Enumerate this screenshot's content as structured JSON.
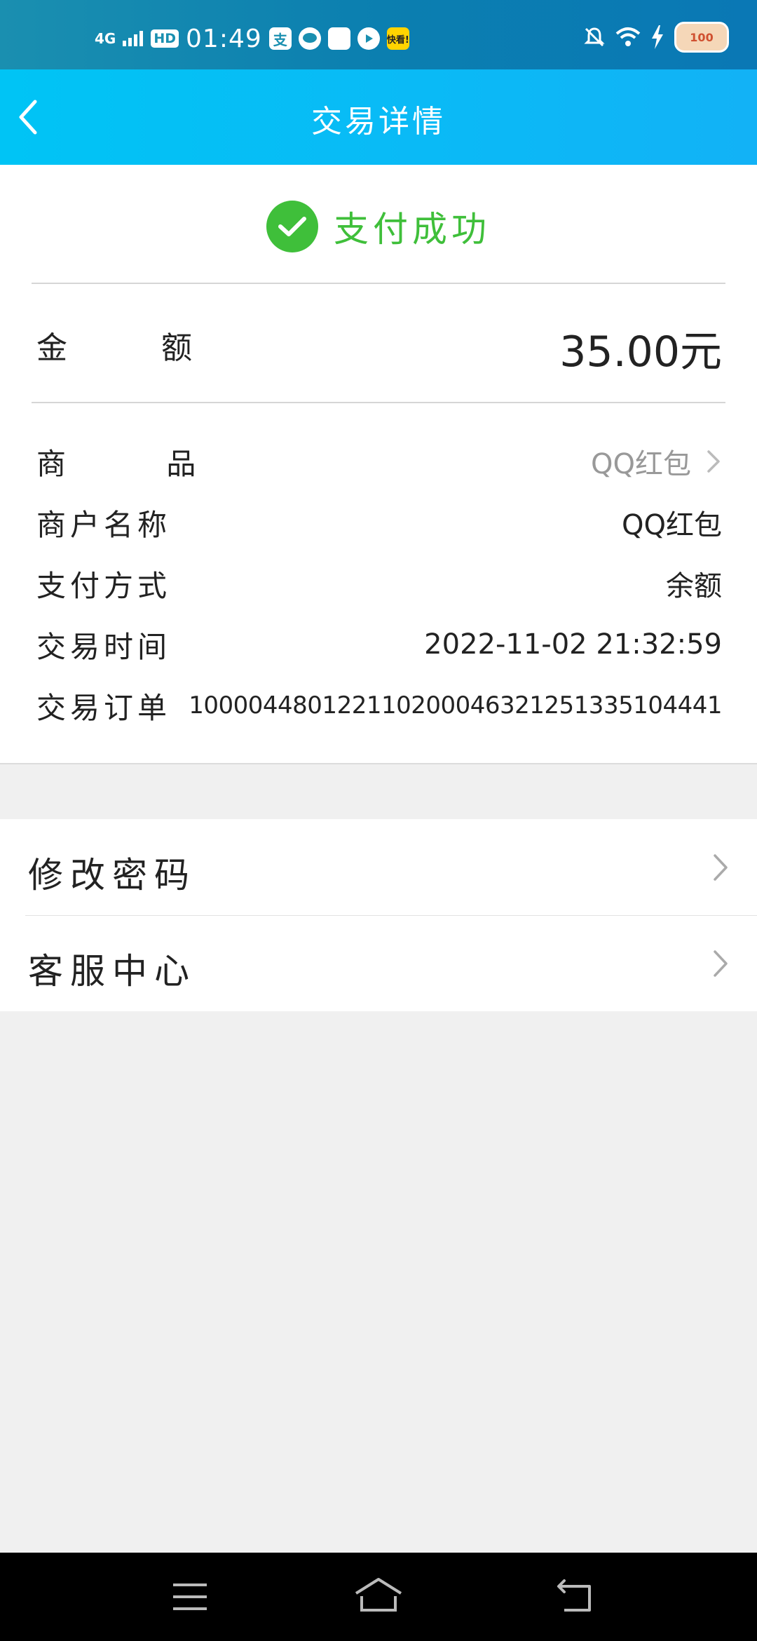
{
  "status_bar": {
    "signal": "4G",
    "hd": "HD",
    "time": "01:49",
    "app_icons": [
      "alipay-icon",
      "message-icon",
      "app-icon",
      "video-icon",
      "kuaishou-icon"
    ],
    "kuaishou_text": "快看!",
    "battery_text": "100"
  },
  "nav": {
    "title": "交易详情"
  },
  "status": {
    "text": "支付成功",
    "color": "#3fbf3a"
  },
  "amount": {
    "label": "金 额",
    "value": "35.00元"
  },
  "details": [
    {
      "label": "商 品",
      "value": "QQ红包"
    },
    {
      "label": "商户名称",
      "value": "QQ红包"
    },
    {
      "label": "支付方式",
      "value": "余额"
    },
    {
      "label": "交易时间",
      "value": "2022-11-02 21:32:59"
    },
    {
      "label": "交易订单",
      "value": "100004480122110200046321251335104441"
    }
  ],
  "menu": [
    {
      "label": "修改密码"
    },
    {
      "label": "客服中心"
    }
  ],
  "colors": {
    "nav_gradient_start": "#00c4f5",
    "nav_gradient_end": "#12b2f6",
    "success_green": "#3fbf3a",
    "background": "#f0f0f0"
  }
}
